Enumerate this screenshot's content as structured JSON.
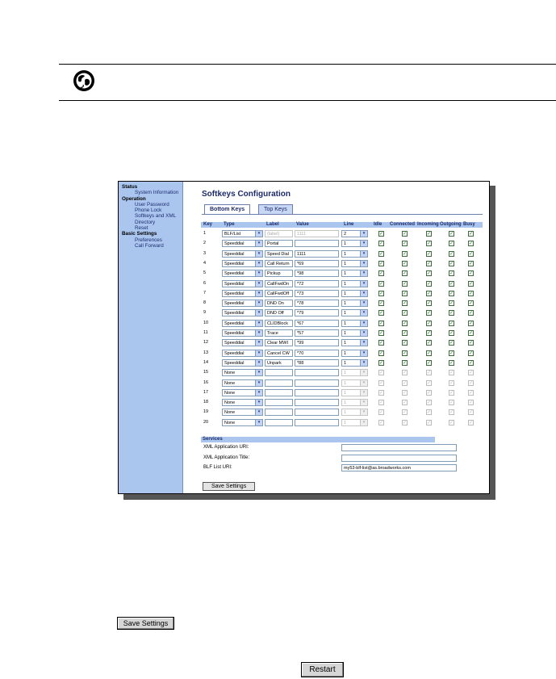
{
  "page": {
    "background": "#ffffff"
  },
  "note_icon": "globe-note-icon",
  "screen": {
    "sidebar": [
      {
        "label": "Status",
        "section": true
      },
      {
        "label": "System Information",
        "section": false
      },
      {
        "label": "Operation",
        "section": true
      },
      {
        "label": "User Password",
        "section": false
      },
      {
        "label": "Phone Lock",
        "section": false
      },
      {
        "label": "Softkeys and XML",
        "section": false
      },
      {
        "label": "Directory",
        "section": false
      },
      {
        "label": "Reset",
        "section": false
      },
      {
        "label": "Basic Settings",
        "section": true
      },
      {
        "label": "Preferences",
        "section": false
      },
      {
        "label": "Call Forward",
        "section": false
      }
    ],
    "title": "Softkeys Configuration",
    "tabs": {
      "bottom": "Bottom Keys",
      "top": "Top Keys"
    },
    "columns": [
      "Key",
      "Type",
      "Label",
      "Value",
      "Line",
      "Idle",
      "Connected",
      "Incoming",
      "Outgoing",
      "Busy"
    ],
    "rows": [
      {
        "key": "1",
        "type": "BLF/List",
        "label": "(label)",
        "value": "1111",
        "line": "2",
        "enabled": true,
        "label_dim": true
      },
      {
        "key": "2",
        "type": "Speeddial",
        "label": "Portal",
        "value": "",
        "line": "1",
        "enabled": true
      },
      {
        "key": "3",
        "type": "Speeddial",
        "label": "Speed Dial",
        "value": "1111",
        "line": "1",
        "enabled": true
      },
      {
        "key": "4",
        "type": "Speeddial",
        "label": "Call Return",
        "value": "*69",
        "line": "1",
        "enabled": true
      },
      {
        "key": "5",
        "type": "Speeddial",
        "label": "Pickup",
        "value": "*98",
        "line": "1",
        "enabled": true
      },
      {
        "key": "6",
        "type": "Speeddial",
        "label": "CallFwdOn",
        "value": "*72",
        "line": "1",
        "enabled": true
      },
      {
        "key": "7",
        "type": "Speeddial",
        "label": "CallFwdOff",
        "value": "*73",
        "line": "1",
        "enabled": true
      },
      {
        "key": "8",
        "type": "Speeddial",
        "label": "DND On",
        "value": "*78",
        "line": "1",
        "enabled": true
      },
      {
        "key": "9",
        "type": "Speeddial",
        "label": "DND Off",
        "value": "*79",
        "line": "1",
        "enabled": true
      },
      {
        "key": "10",
        "type": "Speeddial",
        "label": "CLIDBlock",
        "value": "*67",
        "line": "1",
        "enabled": true
      },
      {
        "key": "11",
        "type": "Speeddial",
        "label": "Trace",
        "value": "*57",
        "line": "1",
        "enabled": true
      },
      {
        "key": "12",
        "type": "Speeddial",
        "label": "Clear MWI",
        "value": "*99",
        "line": "1",
        "enabled": true
      },
      {
        "key": "13",
        "type": "Speeddial",
        "label": "Cancel CW",
        "value": "*70",
        "line": "1",
        "enabled": true
      },
      {
        "key": "14",
        "type": "Speeddial",
        "label": "Unpark",
        "value": "*88",
        "line": "1",
        "enabled": true
      },
      {
        "key": "15",
        "type": "None",
        "label": "",
        "value": "",
        "line": "1",
        "enabled": false
      },
      {
        "key": "16",
        "type": "None",
        "label": "",
        "value": "",
        "line": "1",
        "enabled": false
      },
      {
        "key": "17",
        "type": "None",
        "label": "",
        "value": "",
        "line": "1",
        "enabled": false
      },
      {
        "key": "18",
        "type": "None",
        "label": "",
        "value": "",
        "line": "1",
        "enabled": false
      },
      {
        "key": "19",
        "type": "None",
        "label": "",
        "value": "",
        "line": "1",
        "enabled": false
      },
      {
        "key": "20",
        "type": "None",
        "label": "",
        "value": "",
        "line": "1",
        "enabled": false
      }
    ],
    "services": {
      "header": "Services",
      "xml_uri_label": "XML Application URI:",
      "xml_uri_value": "",
      "xml_title_label": "XML Application Title:",
      "xml_title_value": "",
      "blf_label": "BLF List URI:",
      "blf_value": "my53-blf-list@as.broadworks.com"
    },
    "save_label": "Save Settings"
  },
  "buttons": {
    "save": "Save Settings",
    "restart": "Restart"
  },
  "colors": {
    "sidebar": "#aac6ef",
    "title": "#1d2b6b",
    "check": "#1f7a1f"
  }
}
